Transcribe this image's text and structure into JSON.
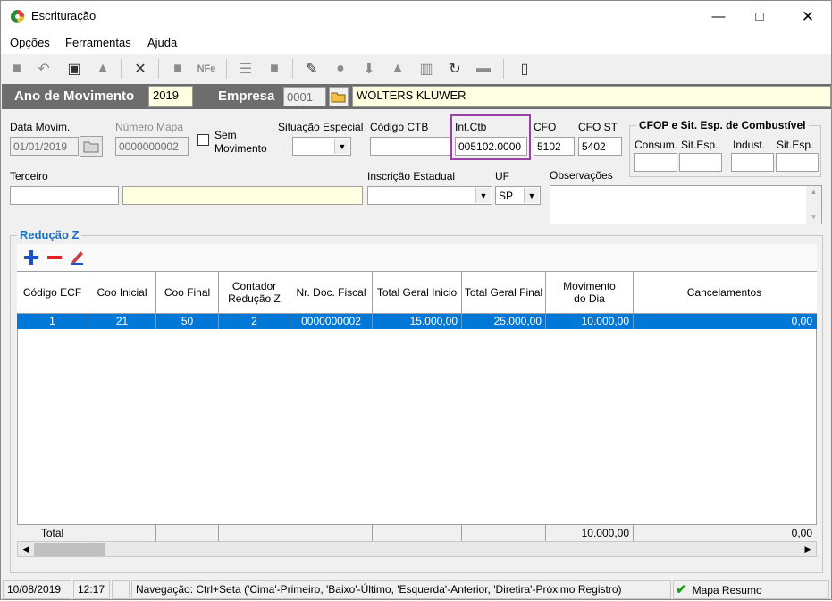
{
  "window": {
    "title": "Escrituração"
  },
  "menu": [
    "Opções",
    "Ferramentas",
    "Ajuda"
  ],
  "header": {
    "ano_label": "Ano de Movimento",
    "ano_value": "2019",
    "empresa_label": "Empresa",
    "empresa_code": "0001",
    "empresa_name": "WOLTERS KLUWER"
  },
  "form": {
    "data_movim_label": "Data Movim.",
    "data_movim_value": "01/01/2019",
    "numero_mapa_label": "Número Mapa",
    "numero_mapa_value": "0000000002",
    "sem_movimento_label_1": "Sem",
    "sem_movimento_label_2": "Movimento",
    "situacao_especial_label": "Situação Especial",
    "situacao_especial_value": "",
    "codigo_ctb_label": "Código CTB",
    "codigo_ctb_value": "",
    "int_ctb_label": "Int.Ctb",
    "int_ctb_value": "005102.0000",
    "cfo_label": "CFO",
    "cfo_value": "5102",
    "cfo_st_label": "CFO ST",
    "cfo_st_value": "5402",
    "cfop_group_title": "CFOP e Sit. Esp. de Combustível",
    "consum_label": "Consum.",
    "sitesp1_label": "Sit.Esp.",
    "indust_label": "Indust.",
    "sitesp2_label": "Sit.Esp.",
    "terceiro_label": "Terceiro",
    "inscricao_label": "Inscrição Estadual",
    "uf_label": "UF",
    "uf_value": "SP",
    "observacoes_label": "Observações"
  },
  "reducao": {
    "title": "Redução Z",
    "columns": [
      "Código ECF",
      "Coo Inicial",
      "Coo Final",
      "Contador Redução Z",
      "Nr. Doc. Fiscal",
      "Total Geral Inicio",
      "Total Geral Final",
      "Movimento do Dia",
      "Cancelamentos"
    ],
    "row": {
      "codigo_ecf": "1",
      "coo_inicial": "21",
      "coo_final": "50",
      "contador": "2",
      "nr_doc": "0000000002",
      "tg_inicio": "15.000,00",
      "tg_final": "25.000,00",
      "mov_dia": "10.000,00",
      "cancelamentos": "0,00"
    },
    "total_label": "Total",
    "total_mov_dia": "10.000,00",
    "total_cancelamentos": "0,00"
  },
  "status": {
    "date": "10/08/2019",
    "time": "12:17",
    "nav": "Navegação: Ctrl+Seta ('Cima'-Primeiro, 'Baixo'-Último, 'Esquerda'-Anterior, 'Diretira'-Próximo Registro)",
    "mapa": "Mapa Resumo"
  },
  "colors": {
    "accent_purple": "#9b3fa8",
    "selection": "#0078d7",
    "header_bar": "#6d6d6d",
    "yellow_field": "#ffffe1"
  }
}
